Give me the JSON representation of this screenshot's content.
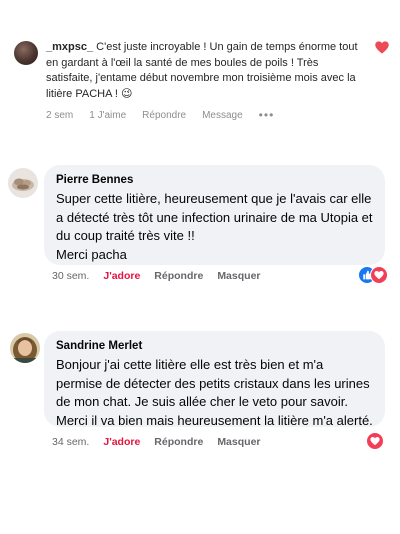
{
  "comment1": {
    "username": "_mxpsc_",
    "text": "C'est juste incroyable ! Un gain de temps énorme tout en gardant à l'œil la santé de mes boules de poils ! Très satisfaite, j'entame début novembre mon troisième mois avec la litière PACHA ! 😉",
    "time": "2 sem",
    "likes": "1 J'aime",
    "reply_label": "Répondre",
    "message_label": "Message",
    "more_label": "•••",
    "heart_color": "#ed4956"
  },
  "comment2": {
    "name": "Pierre Bennes",
    "text": "Super cette litière, heureusement que je l'avais car elle a détecté très tôt une infection urinaire de ma Utopia et du coup traité très vite !!",
    "text_line2": "Merci pacha",
    "time": "30 sem.",
    "like_label": "J'adore",
    "reply_label": "Répondre",
    "hide_label": "Masquer",
    "reactions": [
      "like-icon",
      "love-icon"
    ]
  },
  "comment3": {
    "name": "Sandrine Merlet",
    "text": "Bonjour j'ai cette litière elle est très bien et m'a permise de détecter des petits cristaux dans les urines de mon chat. Je suis allée cher le veto pour savoir. Merci il va bien mais heureusement la litière m'a alerté.",
    "time": "34 sem.",
    "like_label": "J'adore",
    "reply_label": "Répondre",
    "hide_label": "Masquer",
    "reactions": [
      "love-icon"
    ]
  },
  "colors": {
    "bubble_bg": "#f0f2f5",
    "love_red": "#f33e58",
    "like_blue": "#1877f2",
    "liked_text": "#e4143f",
    "muted": "#65676b"
  }
}
